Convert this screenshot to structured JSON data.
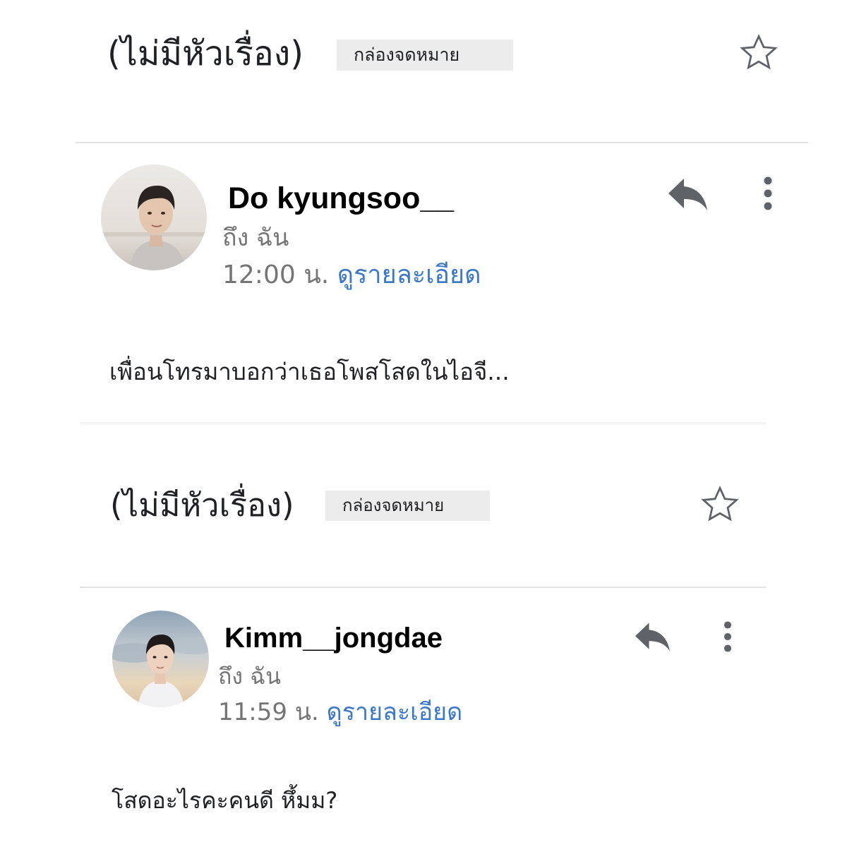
{
  "emails": [
    {
      "subject": "(ไม่มีหัวเรื่อง)",
      "label": "กล่องจดหมาย",
      "sender": "Do kyungsoo__",
      "recipient": "ถึง ฉัน",
      "time": "12:00 น.",
      "details_link": "ดูรายละเอียด",
      "body": "เพื่อนโทรมาบอกว่าเธอโพสโสดในไอจี..."
    },
    {
      "subject": "(ไม่มีหัวเรื่อง)",
      "label": "กล่องจดหมาย",
      "sender": "Kimm__jongdae",
      "recipient": "ถึง ฉัน",
      "time": "11:59 น.",
      "details_link": "ดูรายละเอียด",
      "body": "โสดอะไรคะคนดี หึ้มม?"
    }
  ],
  "icons": {
    "star": "star-outline-icon",
    "reply": "reply-arrow-icon",
    "more": "vertical-dots-icon"
  },
  "colors": {
    "link": "#3b78c9",
    "muted": "#757575",
    "chip": "#ececec",
    "divider": "#e3e3e3",
    "icon": "#5f6368"
  }
}
